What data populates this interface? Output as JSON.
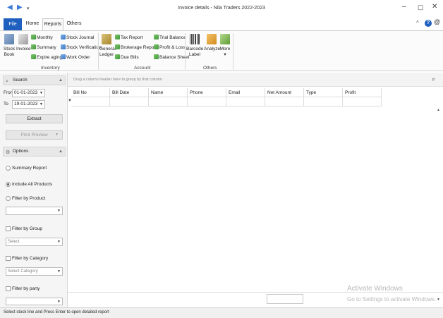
{
  "window": {
    "title": "Invoice details - Nila Traders 2022-2023",
    "controls": {
      "minimize": "–",
      "maximize": "▢",
      "close": "✕"
    }
  },
  "quick_access": {
    "back": "◀",
    "forward": "▶",
    "dropdown": "▾"
  },
  "tabs": {
    "file": "File",
    "items": [
      "Home",
      "Reports",
      "Others"
    ],
    "active": "Reports",
    "right_icons": {
      "collapse": "^",
      "help": "?",
      "account": "@"
    }
  },
  "ribbon": {
    "inventory": {
      "label": "Inventory",
      "big": [
        {
          "line1": "Stock",
          "line2": "Book"
        },
        {
          "line1": "Invoice",
          "line2": ""
        }
      ],
      "small": [
        "Monthly",
        "Summary",
        "Expire aging",
        "Stock Journal",
        "Stock Verification",
        "Work Order"
      ]
    },
    "account": {
      "label": "Account",
      "big": [
        {
          "line1": "General",
          "line2": "Ledger"
        }
      ],
      "small": [
        "Tax Report",
        "Brokerage Report",
        "Due Bills",
        "Trial Balance",
        "Profit & Loss",
        "Balance Sheet"
      ]
    },
    "others": {
      "label": "Others",
      "big": [
        {
          "line1": "Barcode",
          "line2": "Label"
        },
        {
          "line1": "Analyze",
          "line2": ""
        },
        {
          "line1": "More",
          "line2": "▾"
        }
      ]
    }
  },
  "left_panel": {
    "search_header": "Search",
    "from_label": "From",
    "from_date": "01-01-2023",
    "to_label": "To",
    "to_date": "19-01-2023",
    "extract": "Extract",
    "print_preview": "Print Preview",
    "options_header": "Options",
    "summary_report": "Summary Report",
    "include_all_products": "Include All Products",
    "filter_by_product": "Filter by Product",
    "filter_by_group": "Filter by Group",
    "group_placeholder": "Select",
    "filter_by_category": "Filter by Category",
    "category_placeholder": "Select Category",
    "filter_by_party": "Filter by party"
  },
  "grid": {
    "group_panel_text": "Drag a column header here to group by that column",
    "columns": [
      "Bill No",
      "Bill Date",
      "Name",
      "Phone",
      "Email",
      "Net Amount",
      "Type",
      "Profit"
    ]
  },
  "watermark": {
    "line1": "Activate Windows",
    "line2": "Go to Settings to activate Windows."
  },
  "status_bar": "Select stock line and Press Enter to open detailed report",
  "colors": {
    "accent": "#1f5fbf"
  }
}
